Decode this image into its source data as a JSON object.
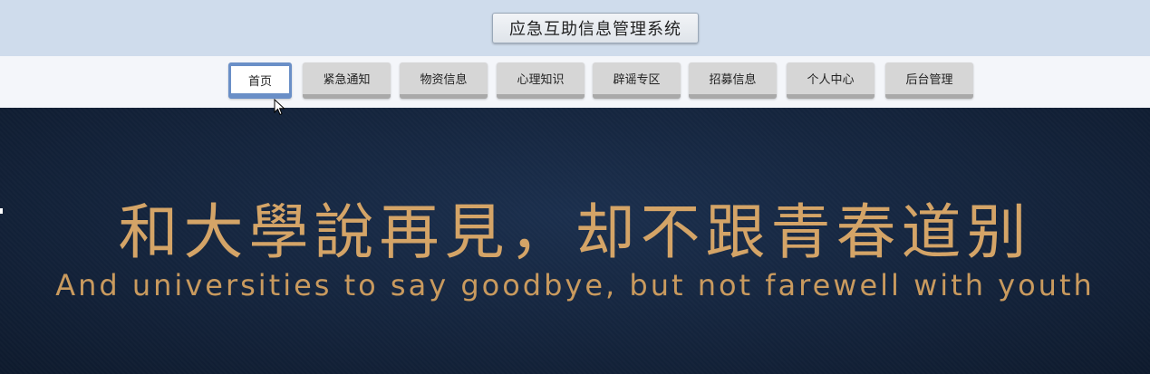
{
  "header": {
    "title": "应急互助信息管理系统"
  },
  "nav": {
    "items": [
      {
        "label": "首页",
        "active": true
      },
      {
        "label": "紧急通知",
        "active": false
      },
      {
        "label": "物资信息",
        "active": false
      },
      {
        "label": "心理知识",
        "active": false
      },
      {
        "label": "辟谣专区",
        "active": false
      },
      {
        "label": "招募信息",
        "active": false
      },
      {
        "label": "个人中心",
        "active": false
      },
      {
        "label": "后台管理",
        "active": false
      }
    ]
  },
  "banner": {
    "title": "和大學說再見，却不跟青春道别",
    "subtitle": "And universities to say goodbye, but not farewell with youth"
  },
  "colors": {
    "banner_bg": "#14243c",
    "banner_text": "#d4a467",
    "nav_active_border": "#6a8fc7"
  }
}
